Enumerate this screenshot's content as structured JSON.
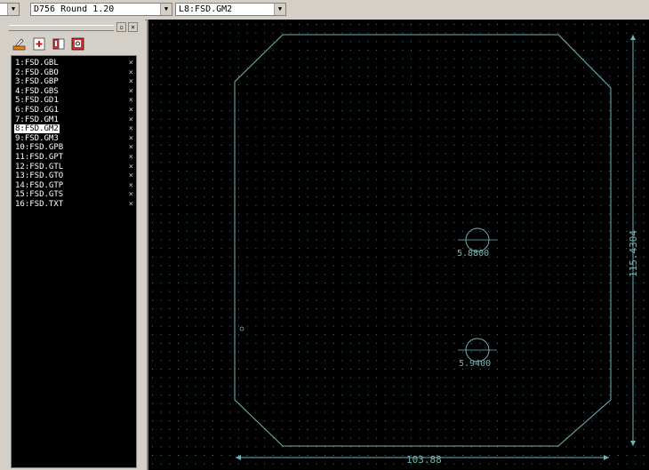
{
  "toolbar": {
    "combo_left": "",
    "tool_combo": "D756  Round 1.20",
    "layer_combo": "L8:FSD.GM2"
  },
  "panel": {
    "close_label": "×",
    "pin_label": "▫",
    "layers": [
      {
        "label": "1:FSD.GBL",
        "remove": "×"
      },
      {
        "label": "2:FSD.GBO",
        "remove": "×"
      },
      {
        "label": "3:FSD.GBP",
        "remove": "×"
      },
      {
        "label": "4:FSD.GBS",
        "remove": "×"
      },
      {
        "label": "5:FSD.GD1",
        "remove": "×"
      },
      {
        "label": "6:FSD.GG1",
        "remove": "×"
      },
      {
        "label": "7:FSD.GM1",
        "remove": "×"
      },
      {
        "label": "8:FSD.GM2",
        "remove": "×",
        "selected": true
      },
      {
        "label": "9:FSD.GM3",
        "remove": "×"
      },
      {
        "label": "10:FSD.GPB",
        "remove": "×"
      },
      {
        "label": "11:FSD.GPT",
        "remove": "×"
      },
      {
        "label": "12:FSD.GTL",
        "remove": "×"
      },
      {
        "label": "13:FSD.GTO",
        "remove": "×"
      },
      {
        "label": "14:FSD.GTP",
        "remove": "×"
      },
      {
        "label": "15:FSD.GTS",
        "remove": "×"
      },
      {
        "label": "16:FSD.TXT",
        "remove": "×"
      }
    ]
  },
  "canvas": {
    "dim_width": "103.88",
    "dim_height": "115.4304",
    "hole1_label": "5.8800",
    "hole2_label": "5.9400",
    "outline_color": "#6fb3b3",
    "grid_color": "#3c8c8c"
  }
}
